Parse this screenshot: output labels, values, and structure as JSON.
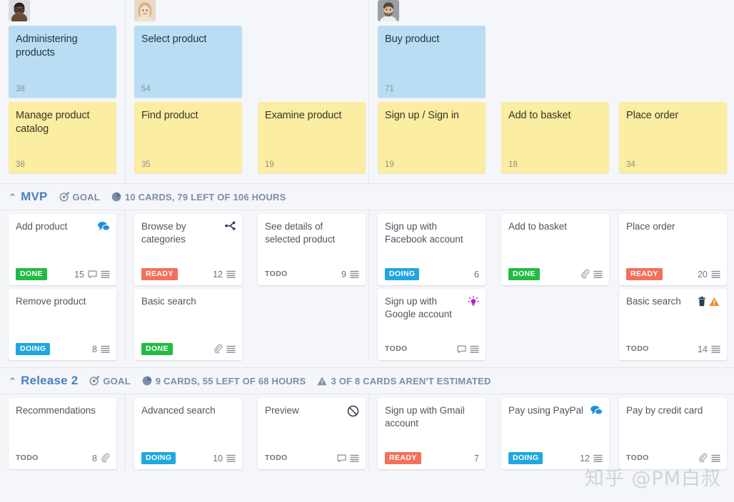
{
  "storymap": {
    "groups": [
      {
        "name": "administering",
        "avatar": "avatar-dark-male",
        "epics": [
          {
            "title": "Administering products",
            "points": "38"
          }
        ],
        "stories": [
          {
            "title": "Manage product catalog",
            "points": "38"
          }
        ]
      },
      {
        "name": "select-product",
        "avatar": "avatar-blonde-female",
        "epics": [
          {
            "title": "Select product",
            "points": "54"
          }
        ],
        "stories": [
          {
            "title": "Find product",
            "points": "35"
          },
          {
            "title": "Examine product",
            "points": "19"
          }
        ]
      },
      {
        "name": "buy-product",
        "avatar": "avatar-bearded-male",
        "epics": [
          {
            "title": "Buy product",
            "points": "71"
          }
        ],
        "stories": [
          {
            "title": "Sign up / Sign in",
            "points": "19"
          },
          {
            "title": "Add to basket",
            "points": "18"
          },
          {
            "title": "Place order",
            "points": "34"
          }
        ]
      }
    ]
  },
  "releases": [
    {
      "name": "MVP",
      "chevron": "⌃",
      "goal_label": "GOAL",
      "stats_label": "10 CARDS, 79 LEFT OF 106 HOURS",
      "warning_label": "",
      "groups": [
        {
          "columns": [
            [
              {
                "title": "Add product",
                "status": "DONE",
                "status_kind": "done",
                "estimate": "15",
                "flag_icon": "comments-filled-icon",
                "foot_icons": [
                  "comment-icon",
                  "description-icon"
                ]
              },
              {
                "title": "Remove product",
                "status": "DOING",
                "status_kind": "doing",
                "estimate": "8",
                "flag_icon": "",
                "foot_icons": [
                  "description-icon"
                ]
              }
            ]
          ]
        },
        {
          "columns": [
            [
              {
                "title": "Browse by categories",
                "status": "READY",
                "status_kind": "ready",
                "estimate": "12",
                "flag_icon": "split-branch-icon",
                "foot_icons": [
                  "description-icon"
                ]
              },
              {
                "title": "Basic search",
                "status": "DONE",
                "status_kind": "done",
                "estimate": "",
                "flag_icon": "",
                "foot_icons": [
                  "attachment-icon",
                  "description-icon"
                ]
              }
            ],
            [
              {
                "title": "See details of selected product",
                "status": "TODO",
                "status_kind": "todo",
                "estimate": "9",
                "flag_icon": "",
                "foot_icons": [
                  "description-icon"
                ]
              },
              {
                "empty": true
              }
            ]
          ]
        },
        {
          "columns": [
            [
              {
                "title": "Sign up with Facebook account",
                "status": "DOING",
                "status_kind": "doing",
                "estimate": "6",
                "flag_icon": "",
                "foot_icons": []
              },
              {
                "title": "Sign up with Google account",
                "status": "TODO",
                "status_kind": "todo",
                "estimate": "",
                "flag_icon": "lightbulb-icon",
                "foot_icons": [
                  "comment-icon",
                  "description-icon"
                ]
              }
            ],
            [
              {
                "title": "Add to basket",
                "status": "DONE",
                "status_kind": "done",
                "estimate": "",
                "flag_icon": "",
                "foot_icons": [
                  "attachment-icon",
                  "description-icon"
                ]
              },
              {
                "empty": true
              }
            ],
            [
              {
                "title": "Place order",
                "status": "READY",
                "status_kind": "ready",
                "estimate": "20",
                "flag_icon": "",
                "foot_icons": [
                  "description-icon"
                ]
              },
              {
                "title": "Basic search",
                "status": "TODO",
                "status_kind": "todo",
                "estimate": "14",
                "flag_icon": "trash-warning-icon",
                "foot_icons": [
                  "description-icon"
                ]
              }
            ]
          ]
        }
      ]
    },
    {
      "name": "Release 2",
      "chevron": "⌃",
      "goal_label": "GOAL",
      "stats_label": "9 CARDS, 55 LEFT OF 68 HOURS",
      "warning_label": "3 OF 8 CARDS AREN'T ESTIMATED",
      "groups": [
        {
          "columns": [
            [
              {
                "title": "Recommendations",
                "status": "TODO",
                "status_kind": "todo",
                "estimate": "8",
                "flag_icon": "",
                "foot_icons": [
                  "attachment-icon"
                ]
              }
            ]
          ]
        },
        {
          "columns": [
            [
              {
                "title": "Advanced search",
                "status": "DOING",
                "status_kind": "doing",
                "estimate": "10",
                "flag_icon": "",
                "foot_icons": [
                  "description-icon"
                ]
              }
            ],
            [
              {
                "title": "Preview",
                "status": "TODO",
                "status_kind": "todo",
                "estimate": "",
                "flag_icon": "blocked-icon",
                "foot_icons": [
                  "comment-icon",
                  "description-icon"
                ]
              }
            ]
          ]
        },
        {
          "columns": [
            [
              {
                "title": "Sign up with Gmail account",
                "status": "READY",
                "status_kind": "ready",
                "estimate": "7",
                "flag_icon": "",
                "foot_icons": []
              }
            ],
            [
              {
                "title": "Pay using PayPal",
                "status": "DOING",
                "status_kind": "doing",
                "estimate": "12",
                "flag_icon": "comments-filled-icon",
                "foot_icons": [
                  "description-icon"
                ]
              }
            ],
            [
              {
                "title": "Pay by credit card",
                "status": "TODO",
                "status_kind": "todo",
                "estimate": "",
                "flag_icon": "",
                "foot_icons": [
                  "attachment-icon",
                  "description-icon"
                ]
              }
            ]
          ]
        }
      ]
    }
  ],
  "watermark": {
    "text": "知乎 @PM白叔"
  },
  "colors": {
    "epic": "#b9ddf2",
    "story": "#fbeda2",
    "done": "#22bb44",
    "ready": "#f4705c",
    "doing": "#20a7e0",
    "release_accent": "#4a7fc1",
    "warning": "#e8883a",
    "lightbulb": "#c21fd0",
    "background": "#f4f6f9"
  }
}
